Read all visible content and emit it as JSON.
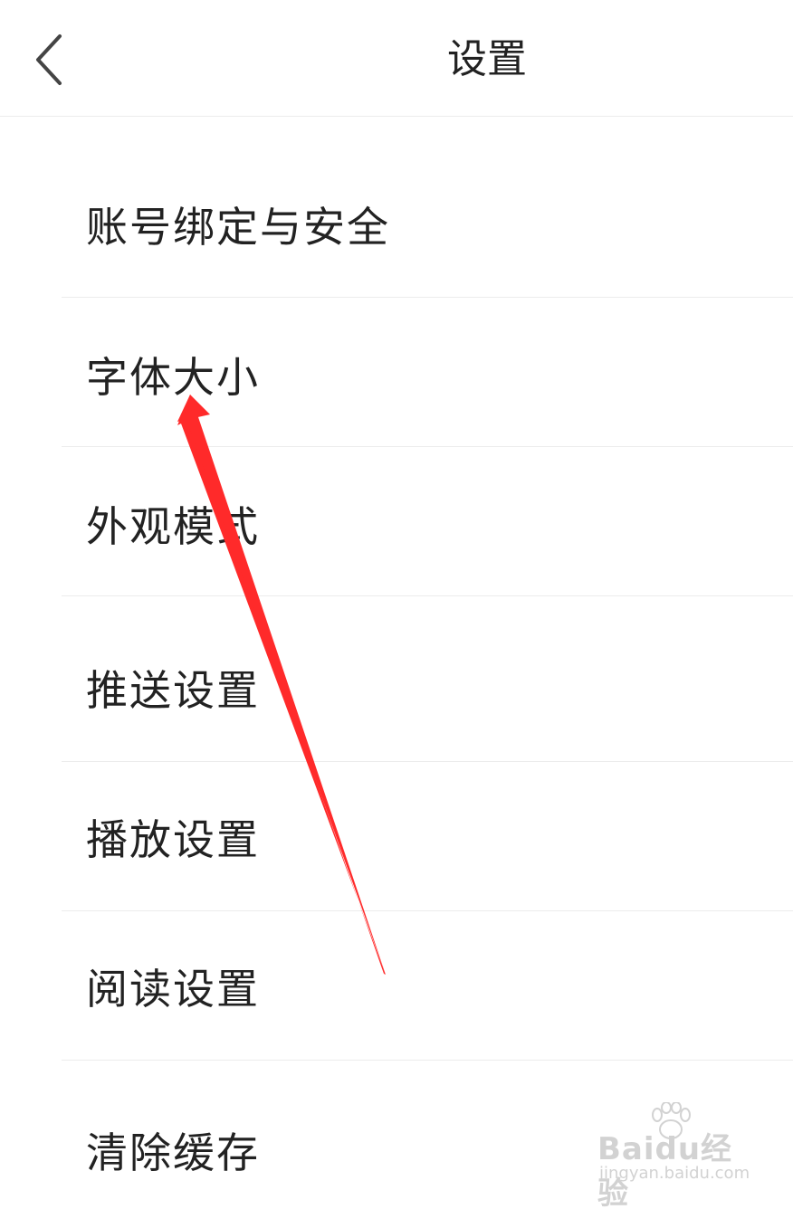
{
  "header": {
    "title": "设置",
    "back_icon": "chevron-left-icon"
  },
  "menu": {
    "items": [
      {
        "label": "账号绑定与安全"
      },
      {
        "label": "字体大小"
      },
      {
        "label": "外观模式"
      },
      {
        "label": "推送设置"
      },
      {
        "label": "播放设置"
      },
      {
        "label": "阅读设置"
      },
      {
        "label": "清除缓存"
      }
    ]
  },
  "annotation": {
    "arrow_color": "#ff2a2a",
    "points_to": "字体大小"
  },
  "watermark": {
    "logo_text": "Baidu经验",
    "url": "jingyan.baidu.com"
  },
  "colors": {
    "text": "#222222",
    "divider": "#ececec",
    "background": "#ffffff"
  }
}
